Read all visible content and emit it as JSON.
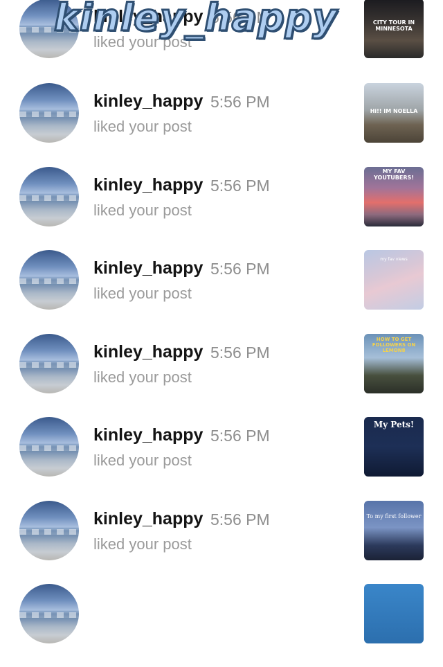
{
  "overlay_text": "kinley_happy",
  "notifications": [
    {
      "username": "kinley_happy",
      "time": "5:56 PM",
      "action": "liked your post",
      "thumb_caption": "CITY TOUR IN MINNESOTA"
    },
    {
      "username": "kinley_happy",
      "time": "5:56 PM",
      "action": "liked your post",
      "thumb_caption": "Hi!! IM NOELLA"
    },
    {
      "username": "kinley_happy",
      "time": "5:56 PM",
      "action": "liked your post",
      "thumb_caption": "MY FAV YOUTUBERS!"
    },
    {
      "username": "kinley_happy",
      "time": "5:56 PM",
      "action": "liked your post",
      "thumb_caption": "my fav views"
    },
    {
      "username": "kinley_happy",
      "time": "5:56 PM",
      "action": "liked your post",
      "thumb_caption": "HOW TO GET FOLLOWERS ON LEMON8"
    },
    {
      "username": "kinley_happy",
      "time": "5:56 PM",
      "action": "liked your post",
      "thumb_caption": "My Pets!"
    },
    {
      "username": "kinley_happy",
      "time": "5:56 PM",
      "action": "liked your post",
      "thumb_caption": "To my first follower"
    }
  ],
  "colors": {
    "username": "#141414",
    "meta": "#8e8e8e",
    "overlay_fill": "#aecdf0",
    "overlay_stroke": "#2f4f72"
  }
}
